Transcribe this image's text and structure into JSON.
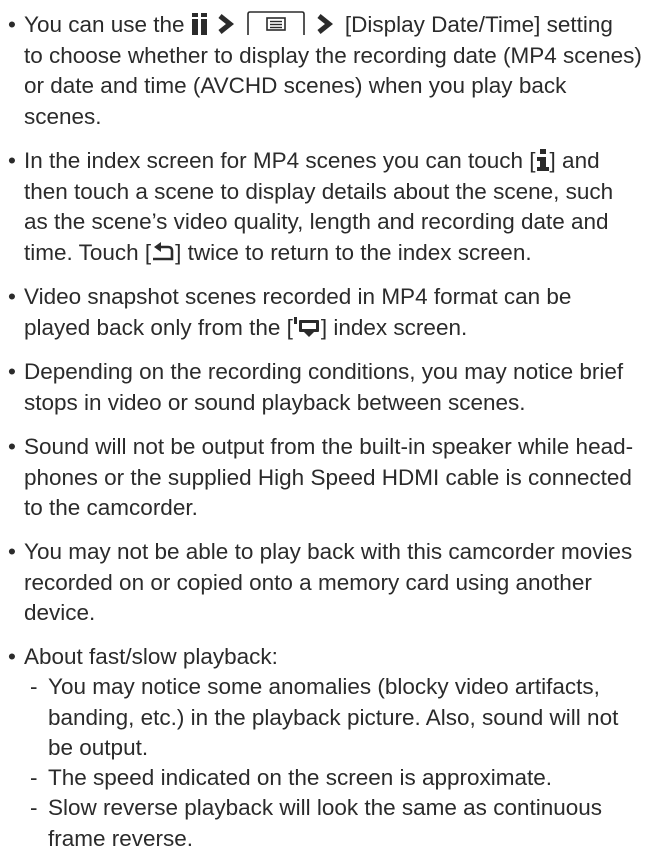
{
  "bullets": [
    {
      "lines": [
        [
          "You can use the",
          "[Display Date/Time] setting"
        ],
        "to choose whether to display the recording date (MP4 scenes)",
        "or date and time (AVCHD scenes) when you play back",
        "scenes."
      ]
    },
    {
      "lines": [
        [
          "In the index screen for MP4 scenes you can touch [",
          "] and"
        ],
        "then touch a scene to display details about the scene, such",
        "as the scene’s video quality, length and recording date and",
        [
          "time. Touch [",
          "] twice to return to the index screen."
        ]
      ]
    },
    {
      "lines": [
        "Video snapshot scenes recorded in MP4 format can be",
        [
          "played back only from the [",
          "] index screen."
        ]
      ]
    },
    {
      "lines": [
        "Depending on the recording conditions, you may notice brief",
        "stops in video or sound playback between scenes."
      ]
    },
    {
      "lines": [
        "Sound will not be output from the built-in speaker while head-",
        "phones or the supplied High Speed HDMI cable is connected",
        "to the camcorder."
      ]
    },
    {
      "lines": [
        "You may not be able to play back with this camcorder movies",
        "recorded on or copied onto a memory card using another",
        "device."
      ]
    },
    {
      "lines": [
        "About fast/slow playback:"
      ],
      "sub": [
        {
          "lines": [
            "You may notice some anomalies (blocky video artifacts,",
            "banding, etc.) in the playback picture. Also, sound will not",
            "be output."
          ]
        },
        {
          "lines": [
            "The speed indicated on the screen is approximate."
          ]
        },
        {
          "lines": [
            "Slow reverse playback will look the same as continuous",
            "frame reverse."
          ]
        }
      ]
    }
  ],
  "symbols": {
    "bullet": "•",
    "dash": "-"
  },
  "icons": {
    "setup": "wrench-icon",
    "step": "arrow-icon",
    "menu": "menu-icon",
    "info": "info-icon",
    "back": "back-icon",
    "video_snapshot": "film-icon"
  }
}
